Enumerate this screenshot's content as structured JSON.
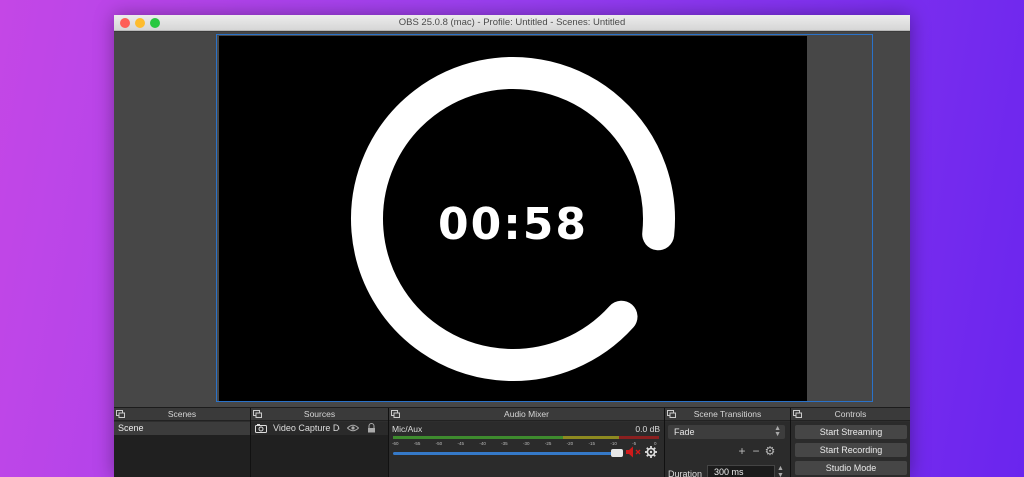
{
  "window": {
    "title": "OBS 25.0.8 (mac) - Profile: Untitled - Scenes: Untitled"
  },
  "preview": {
    "timer": "00:58",
    "ring_fraction": 0.9
  },
  "docks": {
    "scenes": {
      "title": "Scenes",
      "items": [
        "Scene"
      ]
    },
    "sources": {
      "title": "Sources",
      "items": [
        {
          "label": "Video Capture Device",
          "icon": "camera-icon"
        }
      ]
    },
    "mixer": {
      "title": "Audio Mixer",
      "channel": "Mic/Aux",
      "level": "0.0 dB",
      "ticks": [
        "-60",
        "-55",
        "-50",
        "-45",
        "-40",
        "-35",
        "-30",
        "-25",
        "-20",
        "-15",
        "-10",
        "-5",
        "0"
      ],
      "volume_fraction": 1.0
    },
    "transitions": {
      "title": "Scene Transitions",
      "selected": "Fade",
      "duration_label": "Duration",
      "duration_value": "300 ms"
    },
    "controls": {
      "title": "Controls",
      "start_streaming": "Start Streaming",
      "start_recording": "Start Recording",
      "studio_mode": "Studio Mode"
    }
  },
  "colors": {
    "accent": "#2a72c9",
    "meter_green": "#3e8b2e",
    "meter_yellow": "#8e8a20",
    "meter_red": "#8a2020"
  }
}
